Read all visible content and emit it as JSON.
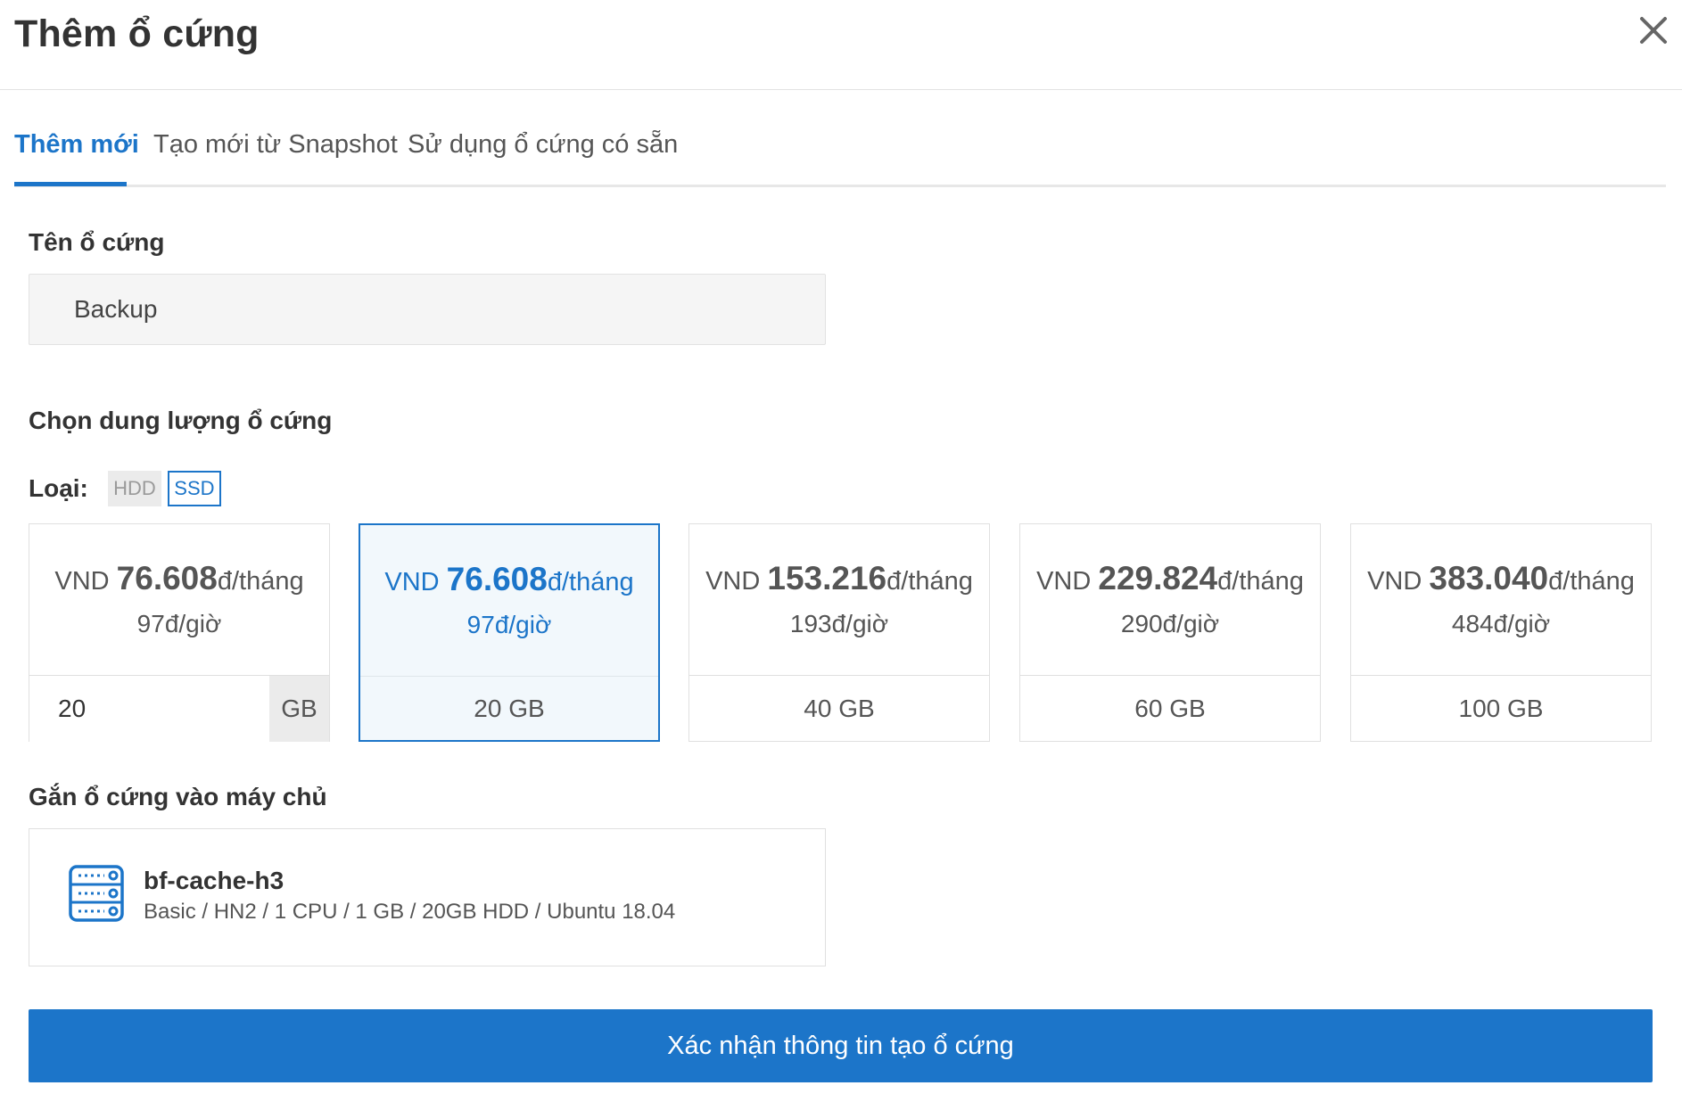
{
  "dialog": {
    "title": "Thêm ổ cứng",
    "close_icon": "close-icon"
  },
  "tabs": [
    {
      "label": "Thêm mới",
      "active": true
    },
    {
      "label": "Tạo mới từ Snapshot",
      "active": false
    },
    {
      "label": "Sử dụng ổ cứng có sẵn",
      "active": false
    }
  ],
  "name_section": {
    "label": "Tên ổ cứng",
    "value": "Backup"
  },
  "capacity_section": {
    "label": "Chọn dung lượng ổ cứng",
    "type_label": "Loại:",
    "types": [
      "HDD",
      "SSD"
    ],
    "selected_type": "SSD",
    "plans": [
      {
        "currency": "VND",
        "price": "76.608",
        "unit": "đ/tháng",
        "hourly": "97đ/giờ",
        "custom_value": "20",
        "size_unit": "GB",
        "custom": true,
        "selected": false
      },
      {
        "currency": "VND",
        "price": "76.608",
        "unit": "đ/tháng",
        "hourly": "97đ/giờ",
        "size": "20 GB",
        "selected": true
      },
      {
        "currency": "VND",
        "price": "153.216",
        "unit": "đ/tháng",
        "hourly": "193đ/giờ",
        "size": "40 GB",
        "selected": false
      },
      {
        "currency": "VND",
        "price": "229.824",
        "unit": "đ/tháng",
        "hourly": "290đ/giờ",
        "size": "60 GB",
        "selected": false
      },
      {
        "currency": "VND",
        "price": "383.040",
        "unit": "đ/tháng",
        "hourly": "484đ/giờ",
        "size": "100 GB",
        "selected": false
      }
    ]
  },
  "attach_section": {
    "label": "Gắn ổ cứng vào máy chủ",
    "server": {
      "icon": "server-icon",
      "name": "bf-cache-h3",
      "description": "Basic / HN2 / 1 CPU / 1 GB / 20GB HDD / Ubuntu 18.04"
    }
  },
  "confirm_button": {
    "label": "Xác nhận thông tin tạo ổ cứng"
  },
  "colors": {
    "accent": "#1c75c9",
    "selected_bg": "#f2f8fc"
  }
}
